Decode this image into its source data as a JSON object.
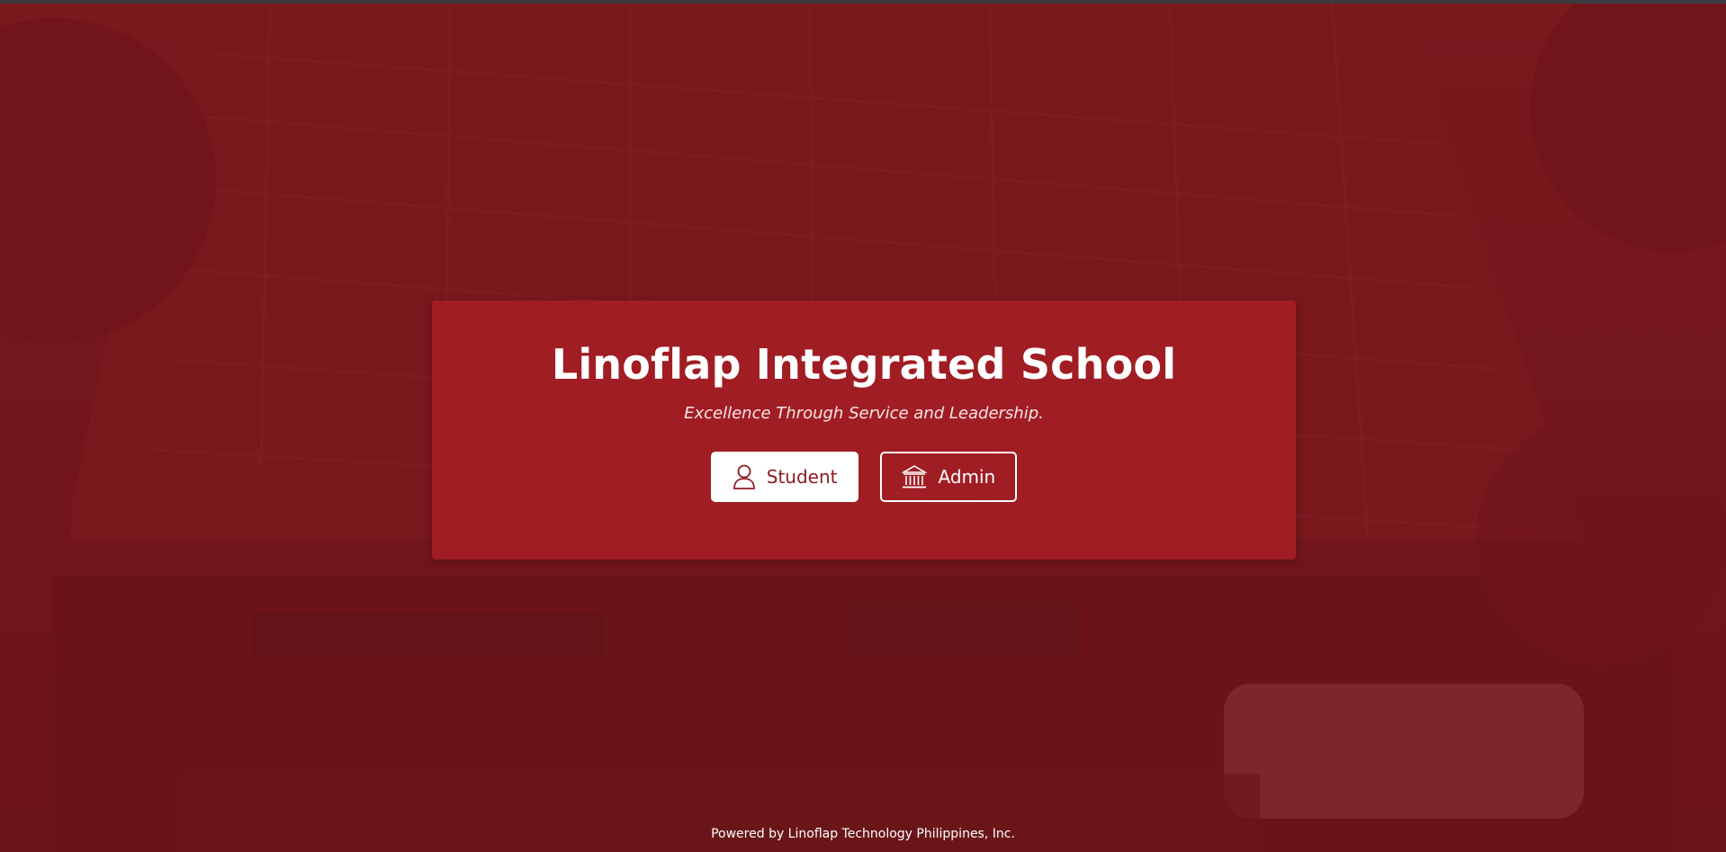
{
  "hero": {
    "title": "Linoflap Integrated School",
    "tagline": "Excellence Through Service and Leadership."
  },
  "buttons": {
    "student": {
      "label": "Student",
      "icon": "user-icon"
    },
    "admin": {
      "label": "Admin",
      "icon": "institution-icon"
    }
  },
  "footer": {
    "text": "Powered by Linoflap Technology Philippines, Inc."
  },
  "colors": {
    "brand_red": "#a91e26",
    "overlay_red": "#781c1f",
    "button_text_red": "#8d1a22",
    "white": "#ffffff"
  }
}
